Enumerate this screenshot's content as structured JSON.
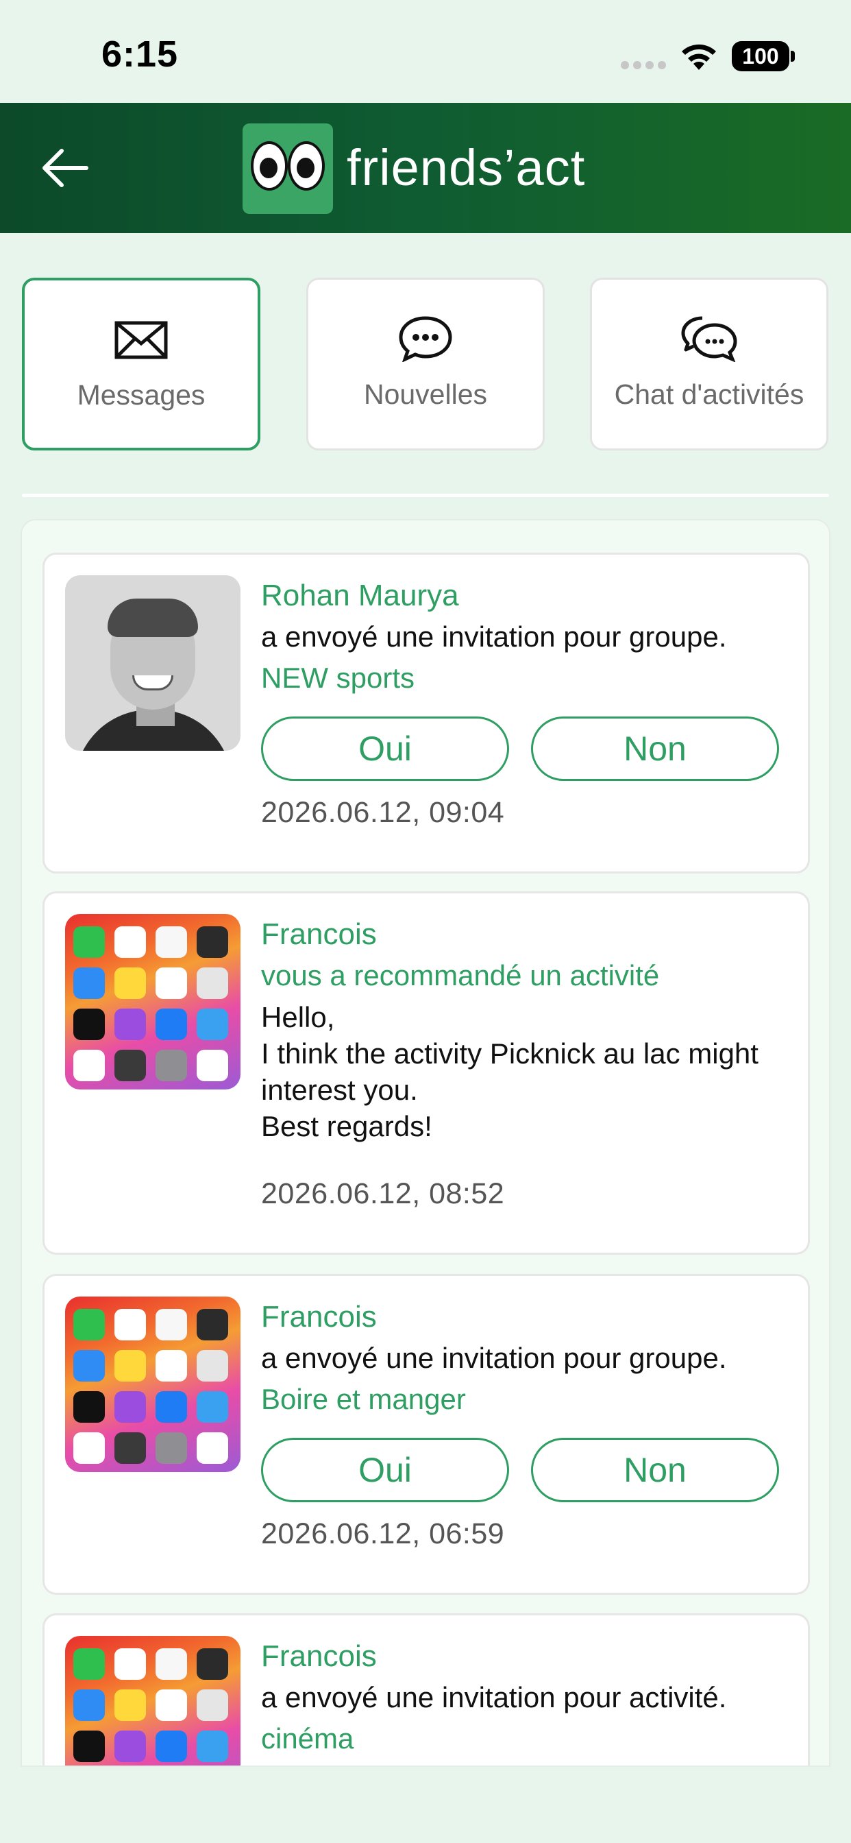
{
  "status_bar": {
    "time": "6:15",
    "battery": "100"
  },
  "header": {
    "app_name": "friends’act"
  },
  "tabs": [
    {
      "label": "Messages",
      "icon": "envelope-icon",
      "active": true
    },
    {
      "label": "Nouvelles",
      "icon": "speech-bubble-icon",
      "active": false
    },
    {
      "label": "Chat d'activités",
      "icon": "chat-bubbles-icon",
      "active": false
    }
  ],
  "messages": [
    {
      "sender": "Rohan Maurya",
      "text": "a envoyé une invitation pour groupe.",
      "target": "NEW sports",
      "yes_label": "Oui",
      "no_label": "Non",
      "timestamp": "2026.06.12, 09:04"
    },
    {
      "sender": "Francois",
      "subtitle": "vous a recommandé un activité",
      "body": "Hello,\n I think the activity Picknick au lac might interest you.\n Best regards!",
      "timestamp": "2026.06.12, 08:52"
    },
    {
      "sender": "Francois",
      "text": "a envoyé une invitation pour groupe.",
      "target": "Boire et manger",
      "yes_label": "Oui",
      "no_label": "Non",
      "timestamp": "2026.06.12, 06:59"
    },
    {
      "sender": "Francois",
      "text": "a envoyé une invitation pour activité.",
      "target": "cinéma"
    }
  ],
  "colors": {
    "accent": "#2e9e63",
    "header_dark": "#0c4a2a",
    "background": "#e8f5ec"
  }
}
